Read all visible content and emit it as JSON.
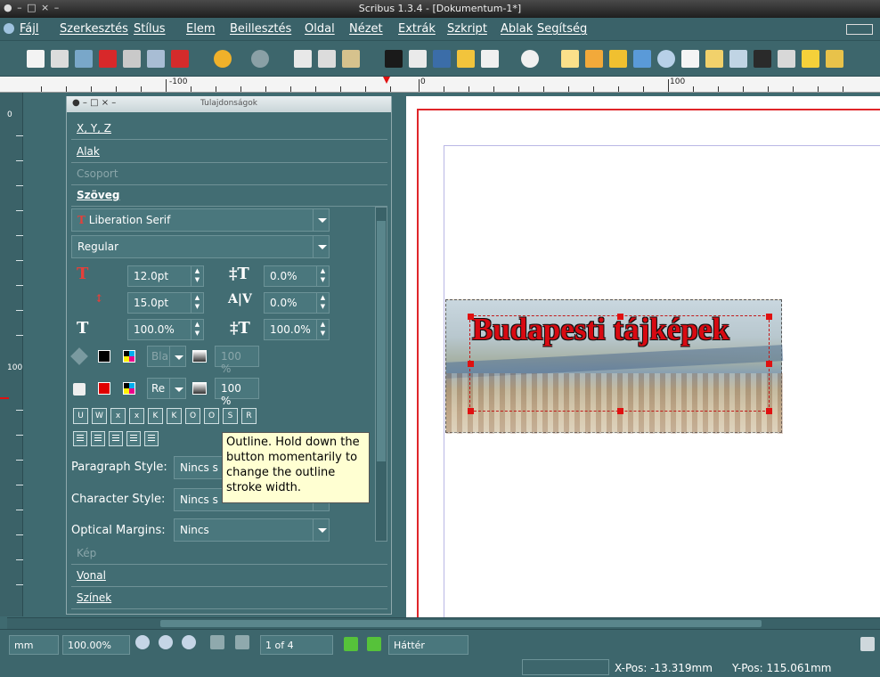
{
  "window": {
    "title": "Scribus 1.3.4 - [Dokumentum-1*]",
    "controls": "● – □ × –"
  },
  "menu": [
    "Fájl",
    "Szerkesztés",
    "Stílus",
    "Elem",
    "Beillesztés",
    "Oldal",
    "Nézet",
    "Extrák",
    "Szkript",
    "Ablak",
    "Segítség"
  ],
  "ruler": {
    "h_labels": [
      "-100",
      "0",
      "100"
    ],
    "v_labels": [
      "0",
      "100"
    ]
  },
  "properties": {
    "title": "Tulajdonságok",
    "controls": "● – □ × –",
    "sections": {
      "xyz": "X, Y, Z",
      "shape": "Alak",
      "group": "Csoport",
      "text": "Szöveg",
      "image": "Kép",
      "line": "Vonal",
      "colors": "Színek"
    },
    "font_family": "Liberation Serif",
    "font_style": "Regular",
    "font_size": "12.0pt",
    "tracking": "0.0%",
    "line_spacing": "15.0pt",
    "kerning": "0.0%",
    "scale_width": "100.0%",
    "scale_height": "100.0%",
    "stroke_shade": "100 %",
    "fill_shade": "100 %",
    "stroke_color_short": "Bla",
    "fill_color_short": "Re",
    "format_buttons": [
      "U",
      "W",
      "x",
      "x",
      "K",
      "K",
      "O",
      "O",
      "S",
      "R"
    ],
    "paragraph_style_label": "Paragraph Style:",
    "paragraph_style_value": "Nincs s",
    "character_style_label": "Character Style:",
    "character_style_value": "Nincs s",
    "optical_margins_label": "Optical Margins:",
    "optical_margins_value": "Nincs"
  },
  "tooltip": "Outline. Hold down the button momentarily to change the outline stroke width.",
  "canvas": {
    "headline": "Budapesti tájképek"
  },
  "status": {
    "unit": "mm",
    "zoom": "100.00%",
    "page": "1 of 4",
    "layer": "Háttér",
    "xpos": "X-Pos: -13.319mm",
    "ypos": "Y-Pos: 115.061mm"
  },
  "colors": {
    "accent_red": "#e0262a",
    "panel": "#426d73",
    "tooltip_bg": "#ffffd2"
  }
}
